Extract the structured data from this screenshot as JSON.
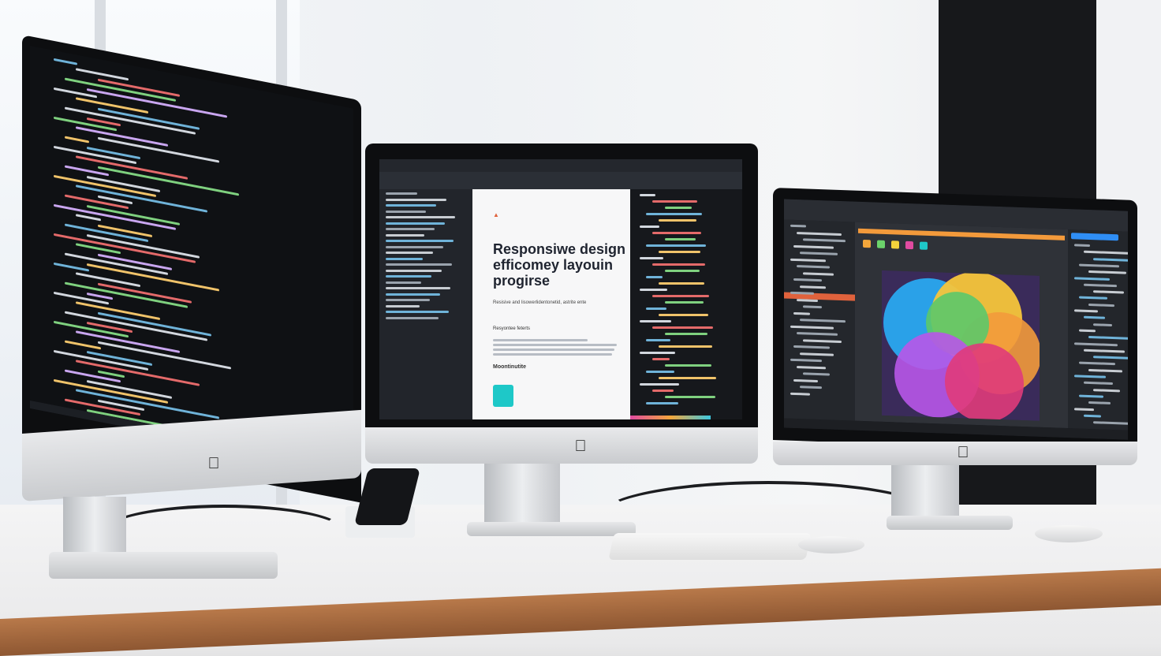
{
  "middle_monitor": {
    "document": {
      "title_line1": "Responsiwe design",
      "title_line2": "efficomey layouin",
      "title_line3": "progirse",
      "caption": "Resisive and lisowerlidentonetid, astrite ente",
      "section_heading": "Resyontee feterts",
      "subheading": "Moontinutite"
    }
  },
  "colors": {
    "bezel": "#0d0e10",
    "code_bg": "#16181c",
    "accent_orange": "#f39a3b",
    "accent_red": "#e0623c",
    "accent_blue": "#2f8ef5",
    "accent_teal": "#1ec8c8"
  }
}
